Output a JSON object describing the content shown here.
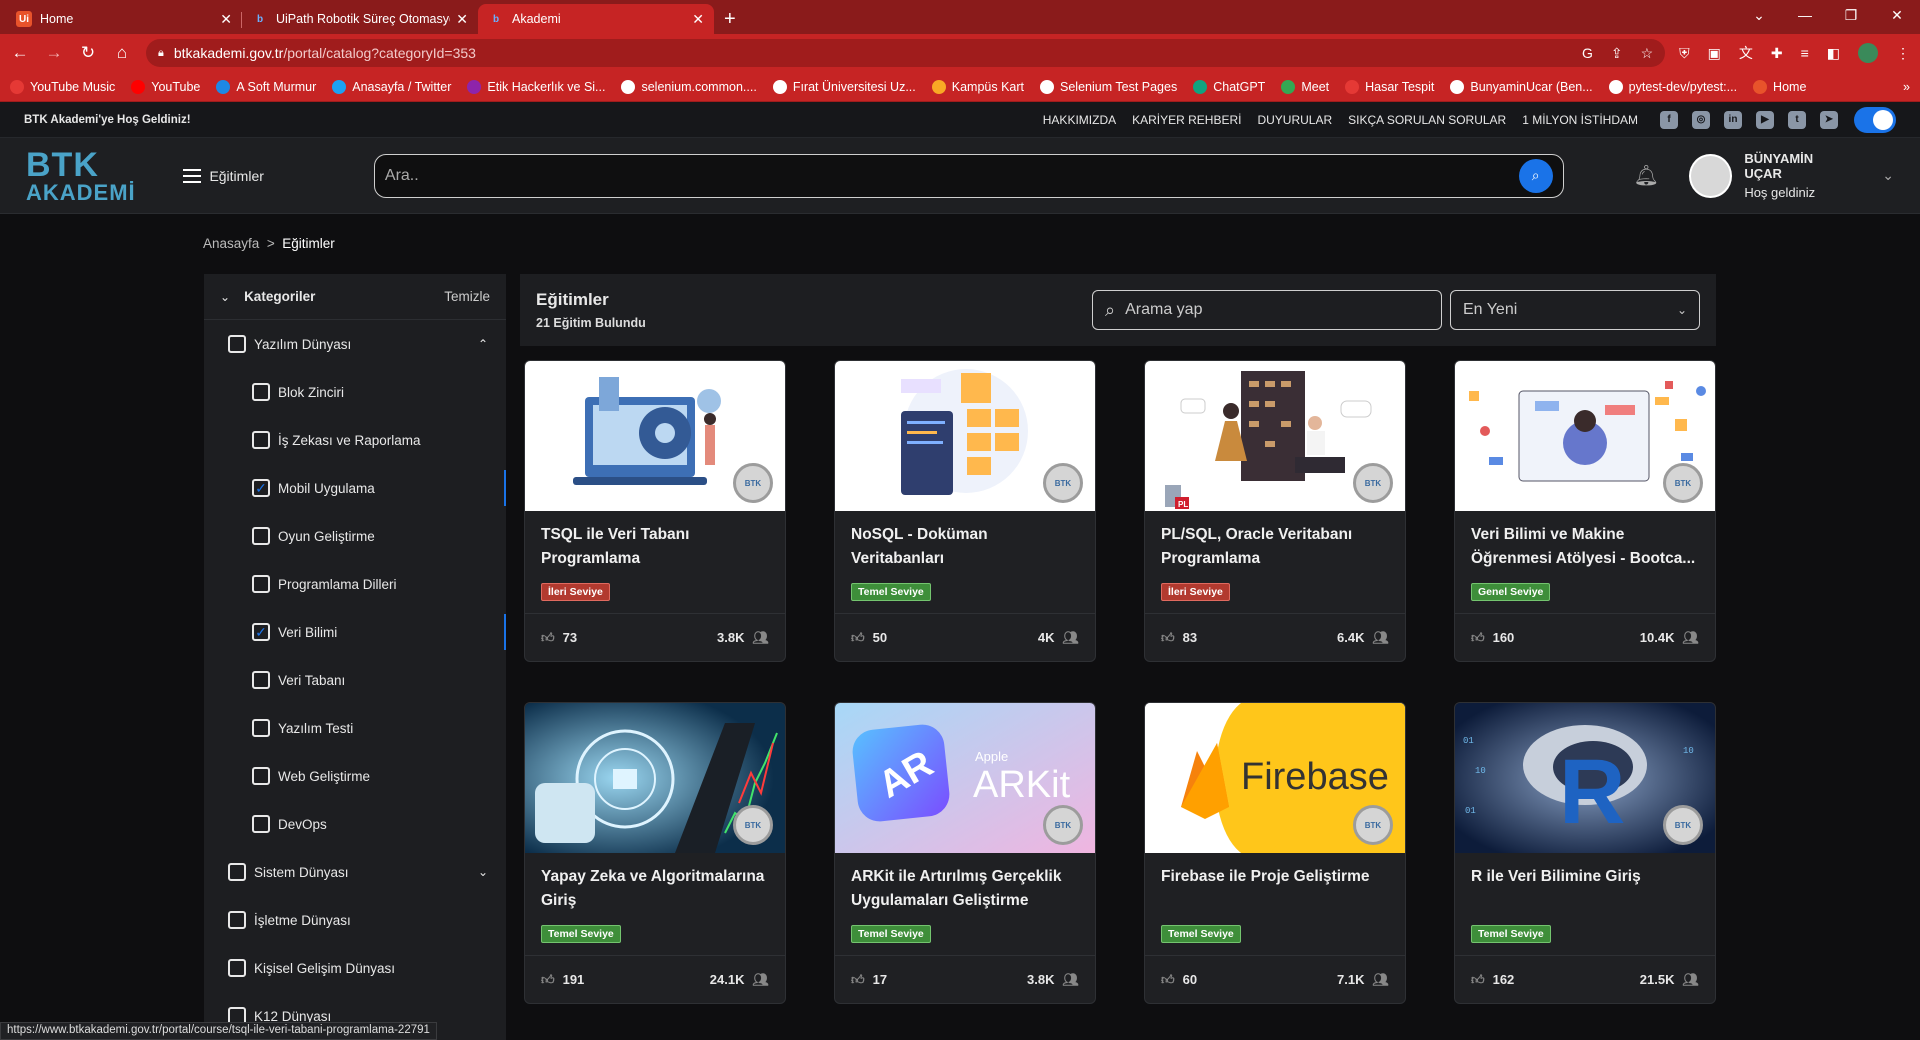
{
  "browser": {
    "tabs": [
      {
        "title": "Home",
        "fav": "Ui",
        "favcolor": "#e8532b",
        "active": false
      },
      {
        "title": "UiPath Robotik Süreç Otomasyon",
        "fav": "b",
        "favcolor": "#3a80c8",
        "active": false
      },
      {
        "title": "Akademi",
        "fav": "b",
        "favcolor": "#3a80c8",
        "active": true
      }
    ],
    "url_host": "btkakademi.gov.tr",
    "url_path": "/portal/catalog?categoryId=353",
    "bookmarks": [
      "YouTube Music",
      "YouTube",
      "A Soft Murmur",
      "Anasayfa / Twitter",
      "Etik Hackerlık ve Si...",
      "selenium.common....",
      "Fırat Üniversitesi Uz...",
      "Kampüs Kart",
      "Selenium Test Pages",
      "ChatGPT",
      "Meet",
      "Hasar Tespit",
      "BunyaminUcar (Ben...",
      "pytest-dev/pytest:...",
      "Home"
    ],
    "status_url": "https://www.btkakademi.gov.tr/portal/course/tsql-ile-veri-tabani-programlama-22791"
  },
  "topstrip": {
    "welcome": "BTK Akademi'ye Hoş Geldiniz!",
    "links": [
      "HAKKIMIZDA",
      "KARİYER REHBERİ",
      "DUYURULAR",
      "SIKÇA SORULAN SORULAR",
      "1 MİLYON İSTİHDAM"
    ]
  },
  "header": {
    "logo_top": "BTK",
    "logo_bottom": "AKADEMİ",
    "menu_label": "Eğitimler",
    "search_placeholder": "Ara..",
    "user_name": "BÜNYAMİN UÇAR",
    "user_greeting": "Hoş geldiniz"
  },
  "breadcrumb": {
    "home": "Anasayfa",
    "sep": ">",
    "current": "Eğitimler"
  },
  "sidebar": {
    "title": "Kategoriler",
    "clear": "Temizle",
    "items": [
      {
        "label": "Yazılım Dünyası",
        "level": 1,
        "checked": false,
        "arrow": "up"
      },
      {
        "label": "Blok Zinciri",
        "level": 2,
        "checked": false
      },
      {
        "label": "İş Zekası ve Raporlama",
        "level": 2,
        "checked": false
      },
      {
        "label": "Mobil Uygulama",
        "level": 2,
        "checked": true
      },
      {
        "label": "Oyun Geliştirme",
        "level": 2,
        "checked": false
      },
      {
        "label": "Programlama Dilleri",
        "level": 2,
        "checked": false
      },
      {
        "label": "Veri Bilimi",
        "level": 2,
        "checked": true
      },
      {
        "label": "Veri Tabanı",
        "level": 2,
        "checked": false
      },
      {
        "label": "Yazılım Testi",
        "level": 2,
        "checked": false
      },
      {
        "label": "Web Geliştirme",
        "level": 2,
        "checked": false
      },
      {
        "label": "DevOps",
        "level": 2,
        "checked": false
      },
      {
        "label": "Sistem Dünyası",
        "level": 1,
        "checked": false,
        "arrow": "down"
      },
      {
        "label": "İşletme Dünyası",
        "level": 1,
        "checked": false
      },
      {
        "label": "Kişisel Gelişim Dünyası",
        "level": 1,
        "checked": false
      },
      {
        "label": "K12 Dünyası",
        "level": 1,
        "checked": false
      }
    ]
  },
  "main": {
    "title": "Eğitimler",
    "count": "21 Eğitim Bulundu",
    "search_placeholder": "Arama yap",
    "sort": "En Yeni",
    "courses": [
      {
        "title": "TSQL ile Veri Tabanı Programlama",
        "level": "İleri Seviye",
        "lvl": "ileri",
        "likes": "73",
        "views": "3.8K",
        "theme": "tsql"
      },
      {
        "title": "NoSQL - Doküman Veritabanları",
        "level": "Temel Seviye",
        "lvl": "temel",
        "likes": "50",
        "views": "4K",
        "theme": "nosql"
      },
      {
        "title": "PL/SQL, Oracle Veritabanı Programlama",
        "level": "İleri Seviye",
        "lvl": "ileri",
        "likes": "83",
        "views": "6.4K",
        "theme": "plsql"
      },
      {
        "title": "Veri Bilimi ve Makine Öğrenmesi Atölyesi - Bootca...",
        "level": "Genel Seviye",
        "lvl": "temel",
        "likes": "160",
        "views": "10.4K",
        "theme": "ds"
      },
      {
        "title": "Yapay Zeka ve Algoritmalarına Giriş",
        "level": "Temel Seviye",
        "lvl": "temel",
        "likes": "191",
        "views": "24.1K",
        "theme": "ai"
      },
      {
        "title": "ARKit ile Artırılmış Gerçeklik Uygulamaları Geliştirme",
        "level": "Temel Seviye",
        "lvl": "temel",
        "likes": "17",
        "views": "3.8K",
        "theme": "arkit"
      },
      {
        "title": "Firebase ile Proje Geliştirme",
        "level": "Temel Seviye",
        "lvl": "temel",
        "likes": "60",
        "views": "7.1K",
        "theme": "firebase"
      },
      {
        "title": "R ile Veri Bilimine Giriş",
        "level": "Temel Seviye",
        "lvl": "temel",
        "likes": "162",
        "views": "21.5K",
        "theme": "r"
      }
    ],
    "badge_text": "BTK",
    "arkit_brand": "Apple",
    "arkit_name": "ARKit",
    "arkit_icon": "AR",
    "firebase_name": "Firebase",
    "r_letter": "R",
    "plsql_tag": "PL"
  },
  "colors": {
    "accent": "#1a73e8",
    "chrome": "#c62424",
    "ileri": "#b23a2f",
    "temel": "#3e8e3a"
  }
}
